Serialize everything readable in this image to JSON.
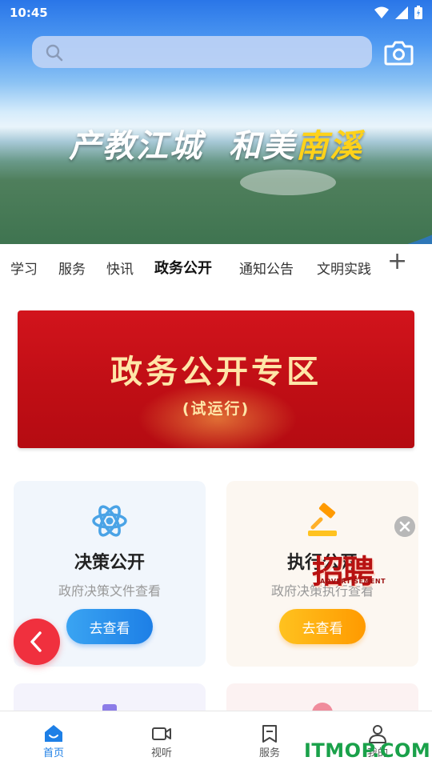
{
  "status_bar": {
    "time": "10:45"
  },
  "search": {
    "placeholder": ""
  },
  "hero": {
    "slogan_part1": "产教江城",
    "slogan_part2_white": "和美",
    "slogan_part2_yellow": "南溪"
  },
  "tabs": [
    {
      "label": "学习",
      "active": false
    },
    {
      "label": "服务",
      "active": false
    },
    {
      "label": "快讯",
      "active": false
    },
    {
      "label": "政务公开",
      "active": true
    },
    {
      "label": "通知公告",
      "active": false
    },
    {
      "label": "文明实践",
      "active": false
    }
  ],
  "tab_add_label": "+",
  "banner": {
    "title": "政务公开专区",
    "subtitle": "(试运行)"
  },
  "cards": [
    {
      "title": "决策公开",
      "desc": "政府决策文件查看",
      "button": "去查看",
      "icon": "atom-icon"
    },
    {
      "title": "执行公开",
      "desc": "政府决策执行查看",
      "button": "去查看",
      "icon": "gavel-icon"
    }
  ],
  "ad": {
    "main_text": "招聘",
    "sub_text": "ADVERTISEMENT"
  },
  "bottom_nav": [
    {
      "label": "首页",
      "icon": "home-icon",
      "active": true
    },
    {
      "label": "视听",
      "icon": "video-icon",
      "active": false
    },
    {
      "label": "服务",
      "icon": "bookmark-icon",
      "active": false
    },
    {
      "label": "我的",
      "icon": "user-icon",
      "active": false
    }
  ],
  "watermark": "ITMOP.COM",
  "colors": {
    "accent_blue": "#1d7fe6",
    "banner_red": "#c00e15",
    "back_button_red": "#f0303e",
    "orange": "#ff9a00"
  }
}
